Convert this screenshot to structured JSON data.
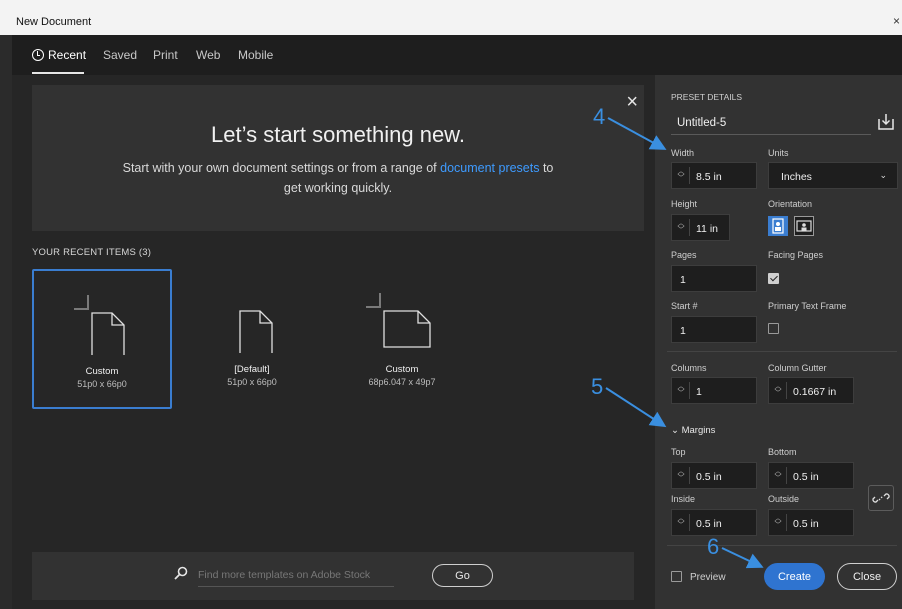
{
  "window": {
    "title": "New Document",
    "close_glyph": "×"
  },
  "tabs": [
    {
      "label": "Recent",
      "active": true,
      "icon": "clock-icon"
    },
    {
      "label": "Saved"
    },
    {
      "label": "Print"
    },
    {
      "label": "Web"
    },
    {
      "label": "Mobile"
    }
  ],
  "hero": {
    "heading": "Let’s start something new.",
    "text_before": "Start with your own document settings or from a range of ",
    "link": "document presets",
    "text_after_line1": " to",
    "text_line2": "get working quickly.",
    "close_glyph": "×"
  },
  "recent": {
    "label": "YOUR RECENT ITEMS",
    "count": "(3)",
    "items": [
      {
        "name": "Custom",
        "size": "51p0 x 66p0",
        "selected": true,
        "orientation": "portrait"
      },
      {
        "name": "[Default]",
        "size": "51p0 x 66p0",
        "selected": false,
        "orientation": "portrait"
      },
      {
        "name": "Custom",
        "size": "68p6.047 x 49p7",
        "selected": false,
        "orientation": "landscape"
      }
    ]
  },
  "stock": {
    "placeholder": "Find more templates on Adobe Stock",
    "go_label": "Go"
  },
  "preset": {
    "section_label": "PRESET DETAILS",
    "name": "Untitled-5",
    "width_label": "Width",
    "width_value": "8.5 in",
    "units_label": "Units",
    "units_value": "Inches",
    "height_label": "Height",
    "height_value": "11 in",
    "orientation_label": "Orientation",
    "orientation_selected": "portrait",
    "pages_label": "Pages",
    "pages_value": "1",
    "facing_pages_label": "Facing Pages",
    "facing_pages_checked": true,
    "start_label": "Start #",
    "start_value": "1",
    "primary_text_frame_label": "Primary Text Frame",
    "primary_text_frame_checked": false,
    "columns_label": "Columns",
    "columns_value": "1",
    "gutter_label": "Column Gutter",
    "gutter_value": "0.1667 in",
    "margins_label": "Margins",
    "top_label": "Top",
    "top_value": "0.5 in",
    "bottom_label": "Bottom",
    "bottom_value": "0.5 in",
    "inside_label": "Inside",
    "inside_value": "0.5 in",
    "outside_label": "Outside",
    "outside_value": "0.5 in"
  },
  "footer": {
    "preview_label": "Preview",
    "preview_checked": false,
    "create_label": "Create",
    "close_label": "Close"
  },
  "callouts": [
    "4",
    "5",
    "6"
  ],
  "colors": {
    "accent": "#2f74d0",
    "link": "#3e9bff",
    "callout": "#3a8fe0",
    "panel": "#323232",
    "background": "#262626"
  }
}
